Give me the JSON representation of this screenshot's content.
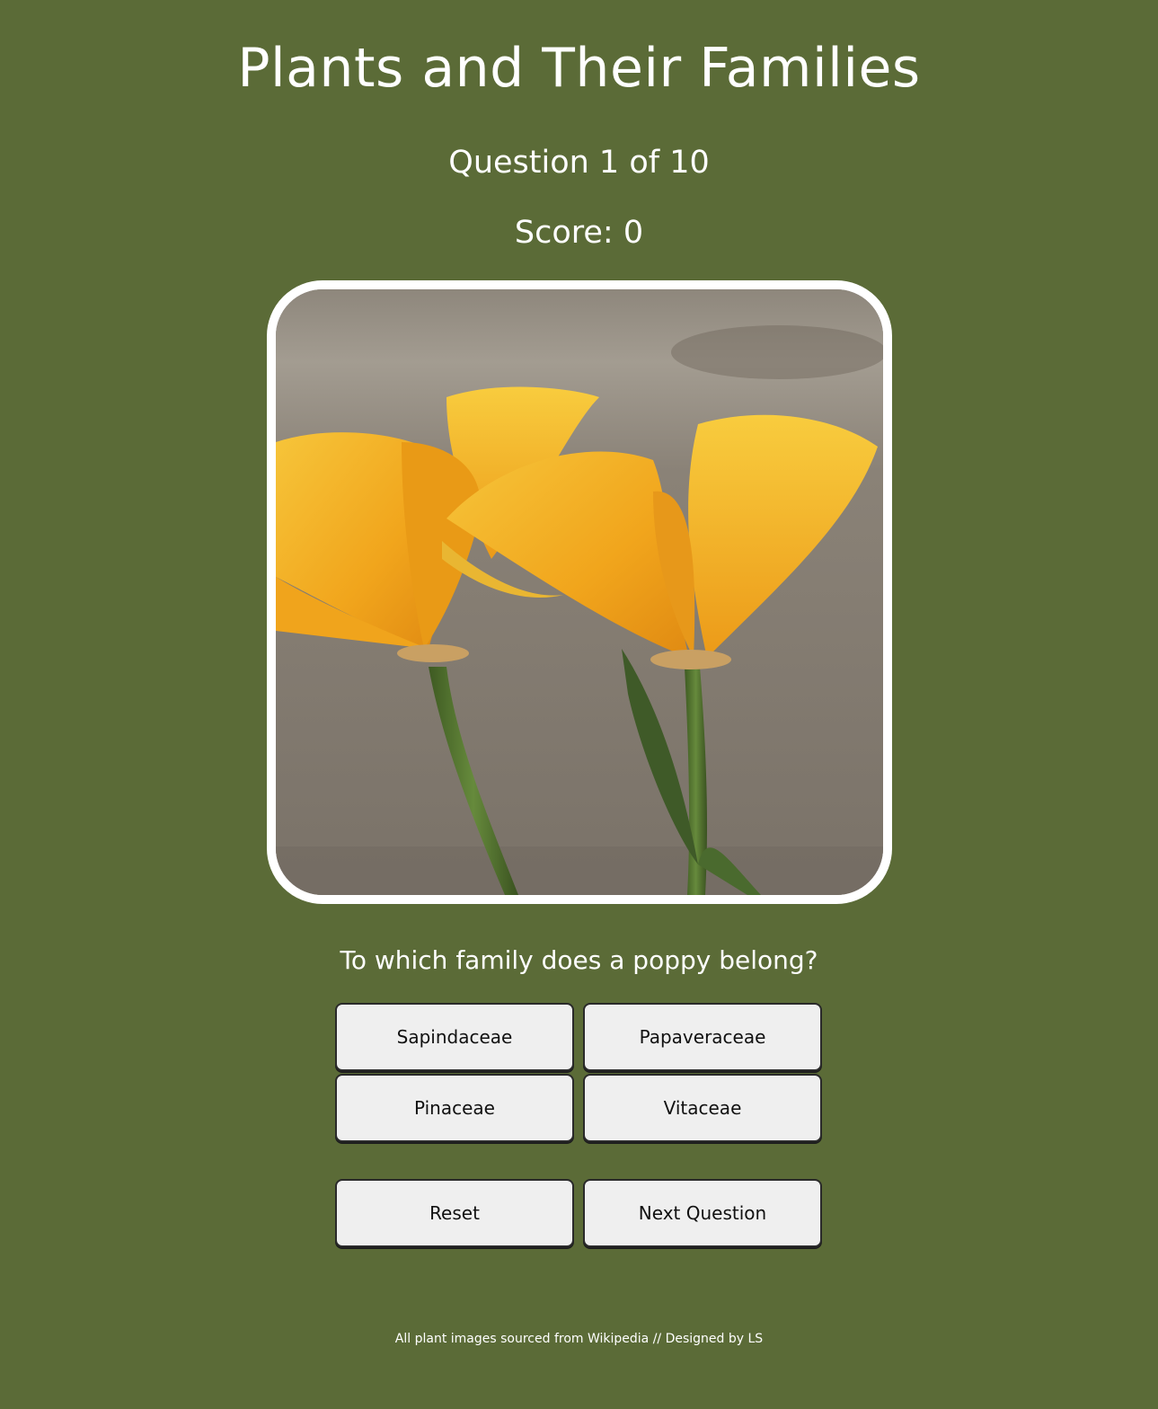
{
  "header": {
    "title": "Plants and Their Families",
    "question_counter": "Question 1 of 10",
    "score": "Score: 0"
  },
  "image": {
    "subject": "yellow poppy flowers"
  },
  "quiz": {
    "question": "To which family does a poppy belong?",
    "answers": [
      "Sapindaceae",
      "Papaveraceae",
      "Pinaceae",
      "Vitaceae"
    ]
  },
  "controls": {
    "reset_label": "Reset",
    "next_label": "Next Question"
  },
  "footer": {
    "text": "All plant images sourced from Wikipedia // Designed by LS"
  },
  "colors": {
    "background": "#5b6b37",
    "text": "#ffffff",
    "button_bg": "#efefef",
    "button_border": "#2a2a2a",
    "petal": "#f2ad1c",
    "stem": "#4e6a2e"
  }
}
